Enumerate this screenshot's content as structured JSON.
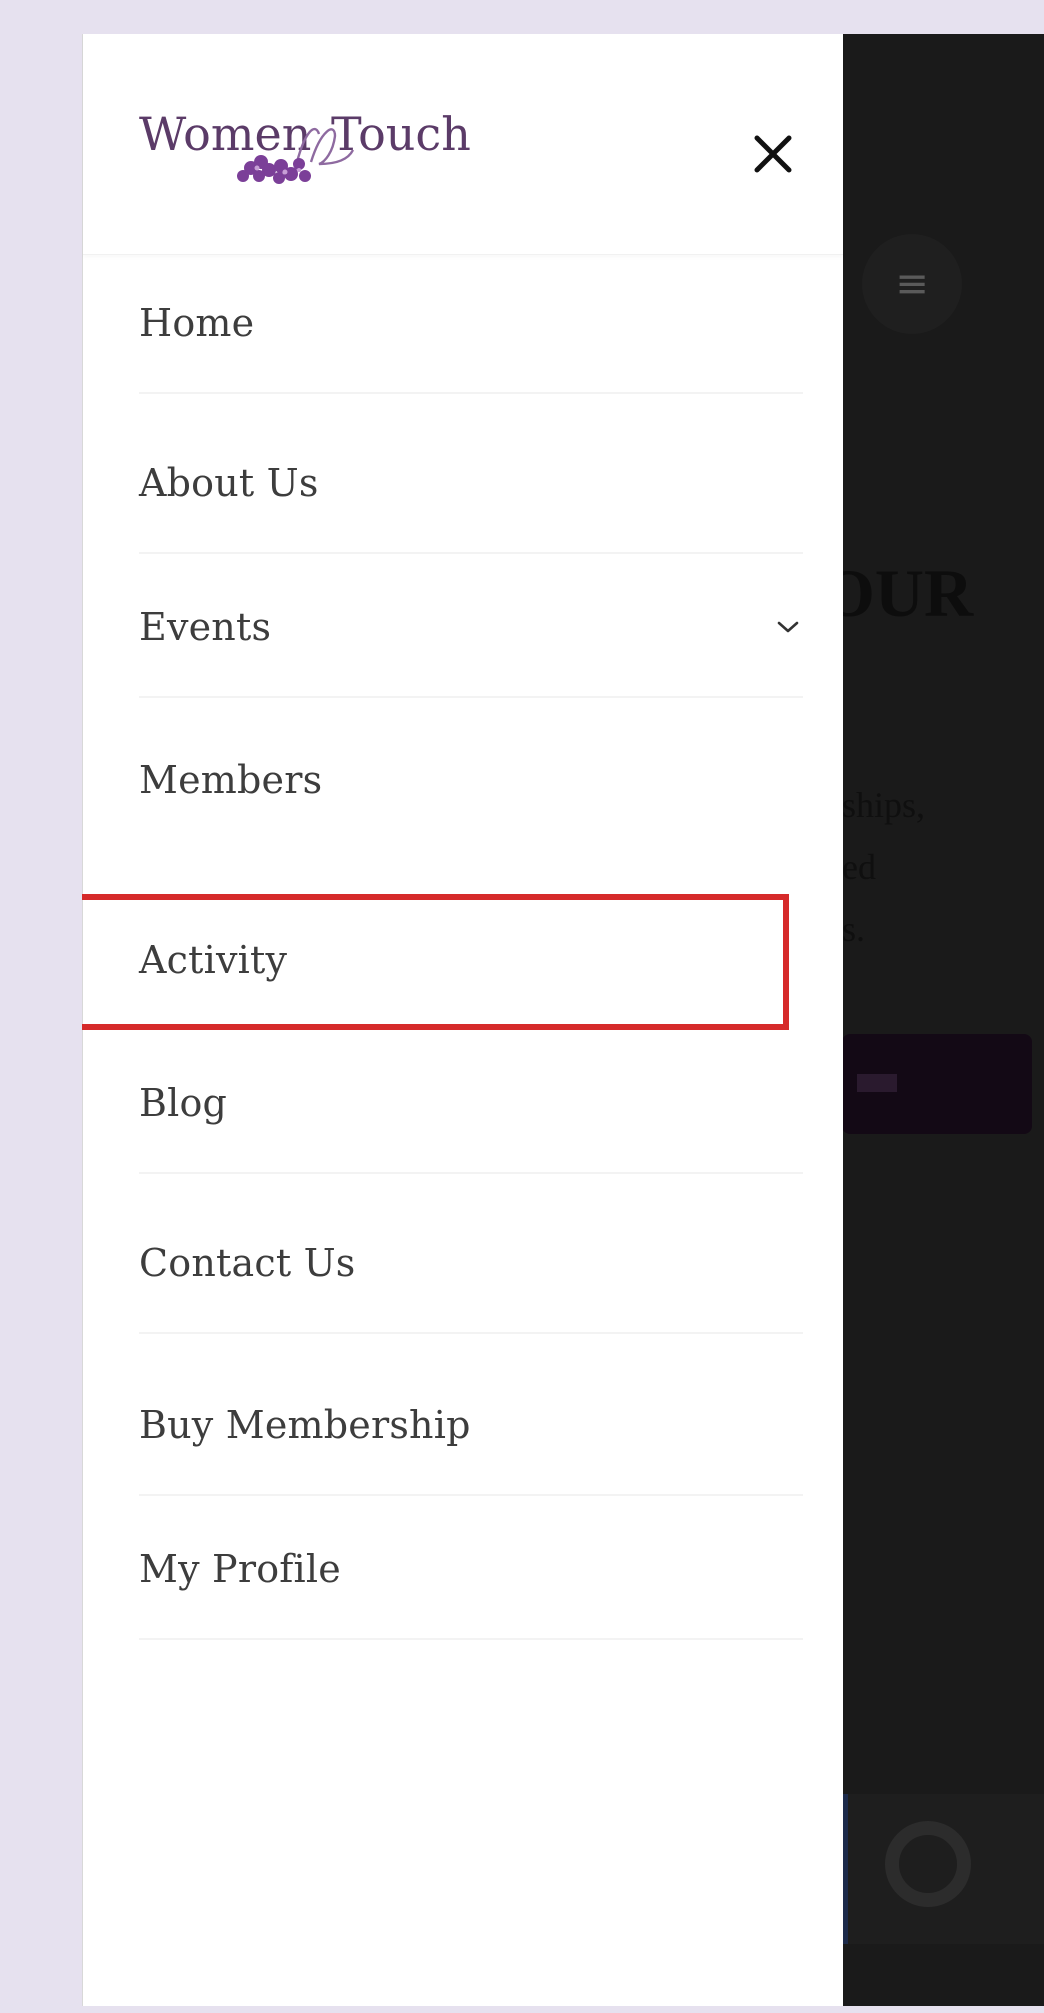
{
  "logo": {
    "text": "Women in Touch",
    "accent_color": "#5b3b68",
    "flower_color": "#7b3f98"
  },
  "close_icon": "close-icon",
  "menu": {
    "items": [
      {
        "label": "Home",
        "has_submenu": false
      },
      {
        "label": "About Us",
        "has_submenu": false
      },
      {
        "label": "Events",
        "has_submenu": true,
        "submenu_icon": "chevron-down-icon"
      },
      {
        "label": "Members",
        "has_submenu": false
      },
      {
        "label": "Activity",
        "has_submenu": false,
        "highlighted": true
      },
      {
        "label": "Blog",
        "has_submenu": false
      },
      {
        "label": "Contact Us",
        "has_submenu": false
      },
      {
        "label": "Buy Membership",
        "has_submenu": false
      },
      {
        "label": "My Profile",
        "has_submenu": false
      }
    ]
  },
  "background_page": {
    "hamburger_icon": "hamburger-menu-icon",
    "heading_fragment": "OUR",
    "paragraph_fragment": "ships,\ned\ns.",
    "button_icon": "arrow-icon"
  },
  "colors": {
    "highlight_border": "#d62a2a",
    "drawer_bg": "#ffffff",
    "overlay_bg": "#1a1a1a",
    "outer_bg": "#e6e1ef",
    "menu_text": "#3d3d3d"
  }
}
